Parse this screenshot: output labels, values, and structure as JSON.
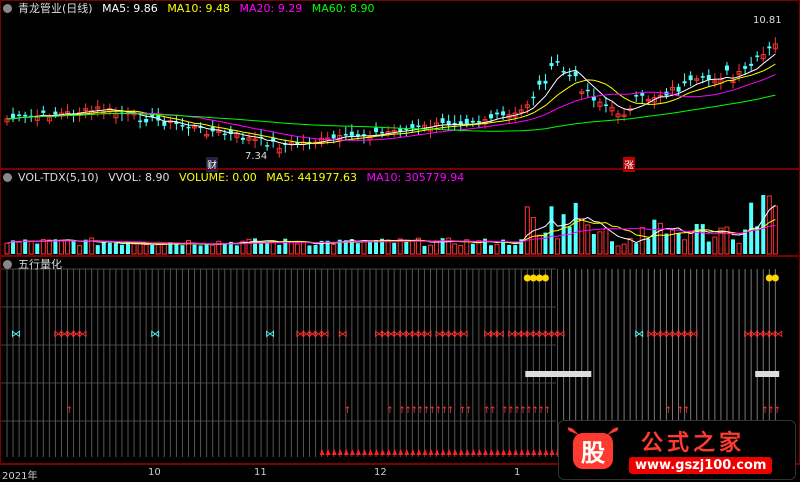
{
  "price_panel": {
    "title": "青龙管业(日线)",
    "ma5": "MA5: 9.86",
    "ma10": "MA10: 9.48",
    "ma20": "MA20: 9.29",
    "ma60": "MA60: 8.90",
    "high_label": "10.81",
    "low_label": "7.34",
    "cai_badge": "财",
    "zhang_badge": "涨",
    "colors": {
      "ma5": "#ffffff",
      "ma10": "#ffff00",
      "ma20": "#ff00ff",
      "ma60": "#00ff00",
      "up": "#ff3333",
      "down": "#54ffff"
    }
  },
  "vol_panel": {
    "title": "VOL-TDX(5,10)",
    "vvol": "VVOL: 8.90",
    "volume": "VOLUME: 0.00",
    "ma5": "MA5: 441977.63",
    "ma10": "MA10: 305779.94"
  },
  "wx_panel": {
    "title": "五行量化"
  },
  "date_axis": {
    "labels": [
      "2021年",
      "10",
      "11",
      "12",
      "1"
    ]
  },
  "watermark": {
    "logo_char": "股",
    "brand": "公式之家",
    "url": "www.gszj100.com"
  }
}
